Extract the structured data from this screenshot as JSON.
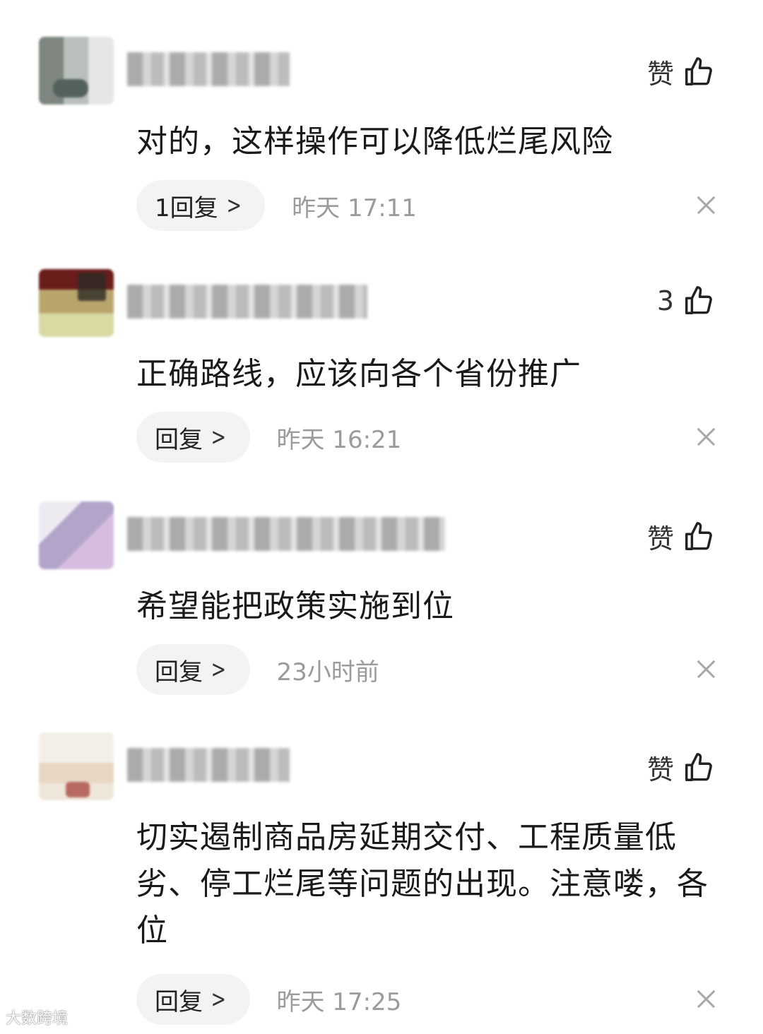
{
  "comments": [
    {
      "like_label": "赞",
      "text": "对的，这样操作可以降低烂尾风险",
      "reply_label": "1回复",
      "time": "昨天  17:11"
    },
    {
      "like_label": "3",
      "text": "正确路线，应该向各个省份推广",
      "reply_label": "回复",
      "time": "昨天  16:21"
    },
    {
      "like_label": "赞",
      "text": "希望能把政策实施到位",
      "reply_label": "回复",
      "time": "23小时前"
    },
    {
      "like_label": "赞",
      "text": "切实遏制商品房延期交付、工程质量低劣、停工烂尾等问题的出现。注意喽，各位",
      "reply_label": "回复",
      "time": "昨天  17:25"
    }
  ],
  "icons": {
    "like": "thumbs-up-icon",
    "reply_arrow": "chevron-right-icon",
    "dismiss": "close-icon"
  },
  "watermark": "大数跨境"
}
